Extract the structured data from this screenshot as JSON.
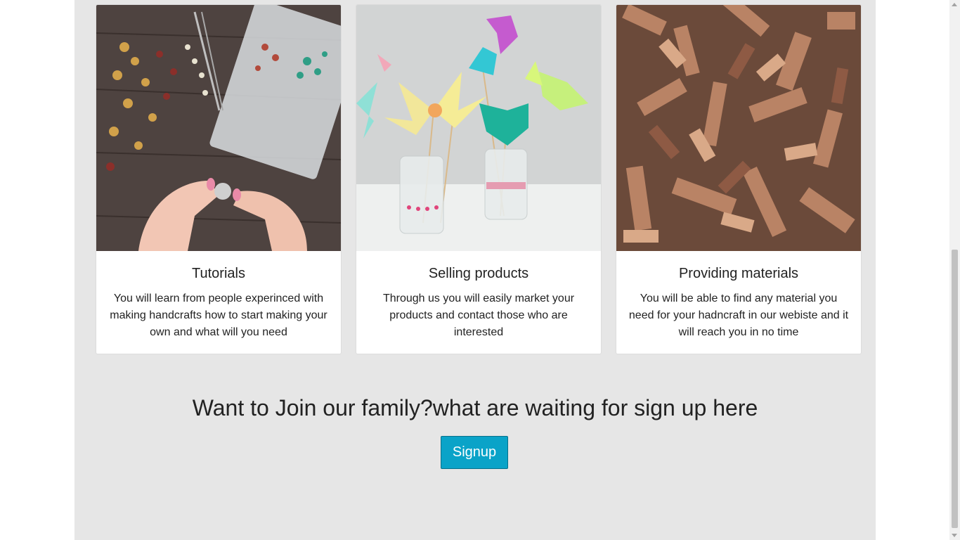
{
  "cards": [
    {
      "image": "jewelry-beads-crafting-photo",
      "title": "Tutorials",
      "text": "You will learn from people experinced with making handcrafts how to start making your own and what will you need"
    },
    {
      "image": "paper-flowers-in-jars-photo",
      "title": "Selling products",
      "text": "Through us you will easily market your products and contact those who are interested"
    },
    {
      "image": "wood-pieces-pile-photo",
      "title": "Providing materials",
      "text": "You will be able to find any material you need for your hadncraft in our webiste and it will reach you in no time"
    }
  ],
  "cta": {
    "heading": "Want to Join our family?what are waiting for sign up here",
    "button_label": "Signup"
  },
  "colors": {
    "page_background": "#e6e6e6",
    "button_background": "#0aa3c8",
    "button_text": "#ffffff"
  }
}
